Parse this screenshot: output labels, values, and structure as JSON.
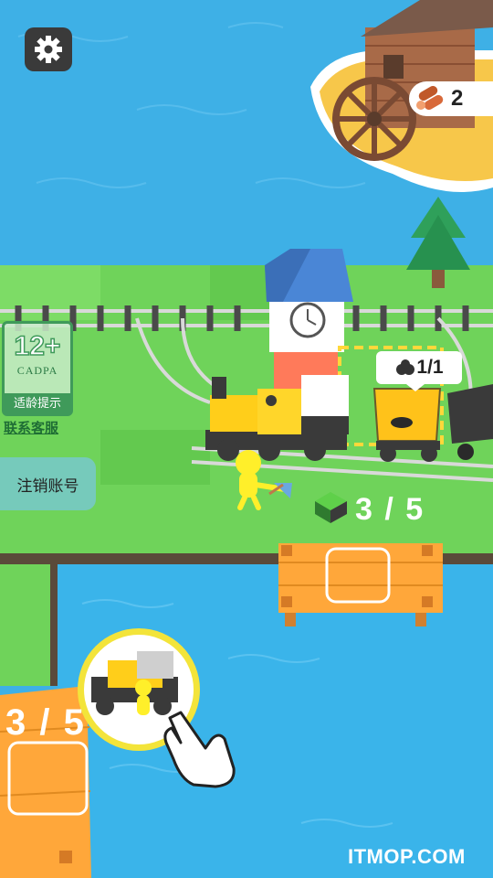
{
  "hud": {
    "settings_icon": "gear-icon",
    "wood_icon": "wood-logs-icon",
    "wood_count": "2"
  },
  "cadpa": {
    "age": "12+",
    "name": "CADPA",
    "tip": "适龄提示"
  },
  "links": {
    "customer_service": "联系客服",
    "logout": "注销账号"
  },
  "train": {
    "coal_icon": "coal-icon",
    "wagon_capacity": "1/1"
  },
  "build": {
    "grass_icon": "grass-block-icon",
    "grass_progress": "3 / 5",
    "bridge_progress": "3 / 5"
  },
  "tutorial": {
    "icon": "pointing-hand-icon"
  },
  "watermark": "ITMOP.COM",
  "colors": {
    "water": "#3eb0e6",
    "grass": "#6fd35a",
    "plank": "#ffa73a",
    "locomotive": "#ffce1a",
    "hud_dark": "#3a3a3a"
  }
}
